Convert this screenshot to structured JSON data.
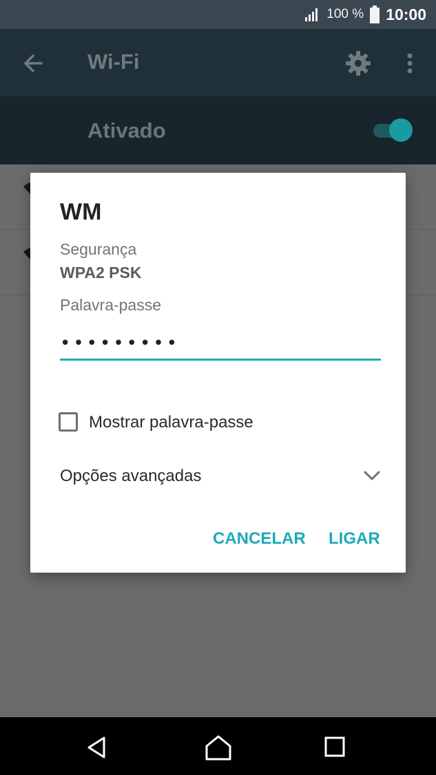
{
  "status_bar": {
    "battery_percent": "100 %",
    "time": "10:00",
    "icons": [
      "signal-icon",
      "battery-icon"
    ]
  },
  "app_bar": {
    "title": "Wi-Fi",
    "icons": [
      "back-arrow-icon",
      "gear-icon",
      "more-vert-icon"
    ]
  },
  "wifi_switch": {
    "label": "Ativado",
    "state": "on",
    "accent_color": "#1a9aa1"
  },
  "dialog": {
    "network_name": "WM",
    "security_label": "Segurança",
    "security_value": "WPA2 PSK",
    "password_label": "Palavra-passe",
    "password_value": "•••••••••",
    "show_password_label": "Mostrar palavra-passe",
    "show_password_checked": false,
    "advanced_options_label": "Opções avançadas",
    "cancel_label": "CANCELAR",
    "connect_label": "LIGAR",
    "accent_color": "#1eaab6"
  },
  "nav_bar": {
    "icons": [
      "nav-back-icon",
      "nav-home-icon",
      "nav-recents-icon"
    ]
  }
}
